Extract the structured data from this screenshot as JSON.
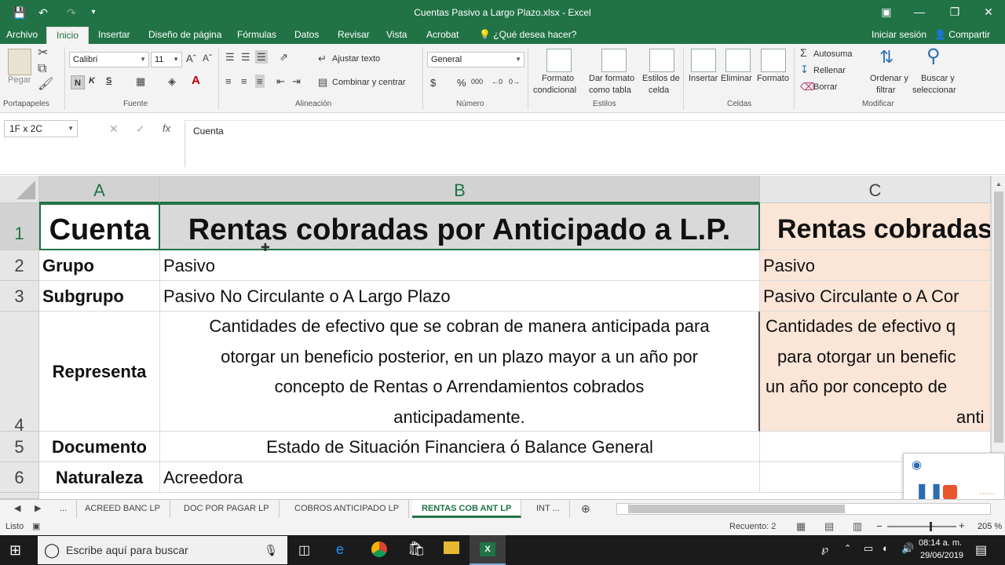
{
  "window": {
    "title": "Cuentas Pasivo a Largo Plazo.xlsx - Excel",
    "accent": "#217346"
  },
  "ribbon_tabs": [
    "Archivo",
    "Inicio",
    "Insertar",
    "Diseño de página",
    "Fórmulas",
    "Datos",
    "Revisar",
    "Vista",
    "Acrobat"
  ],
  "tell_me": "¿Qué desea hacer?",
  "signin": "Iniciar sesión",
  "share": "Compartir",
  "ribbon": {
    "paste": "Pegar",
    "font_name": "Calibri",
    "font_size": "11",
    "bold": "N",
    "italic": "K",
    "underline": "S",
    "wrap_text": "Ajustar texto",
    "merge_center": "Combinar y centrar",
    "number_format": "General",
    "conditional_format": [
      "Formato",
      "condicional"
    ],
    "format_as_table": [
      "Dar formato",
      "como tabla"
    ],
    "cell_styles": [
      "Estilos de",
      "celda"
    ],
    "insert": "Insertar",
    "delete": "Eliminar",
    "format": "Formato",
    "autosum": "Autosuma",
    "fill": "Rellenar",
    "clear": "Borrar",
    "sort_filter": [
      "Ordenar y",
      "filtrar"
    ],
    "find_select": [
      "Buscar y",
      "seleccionar"
    ],
    "groups": [
      "Portapapeles",
      "Fuente",
      "Alineación",
      "Número",
      "Estilos",
      "Celdas",
      "Modificar"
    ]
  },
  "formula_bar": {
    "name_box": "1F x 2C",
    "fx": "fx",
    "content": "Cuenta"
  },
  "columns": [
    "A",
    "B",
    "C"
  ],
  "rows": [
    "1",
    "2",
    "3",
    "4",
    "5",
    "6"
  ],
  "cells": {
    "A1": "Cuenta",
    "B1": "Rentas cobradas por Anticipado a L.P.",
    "C1": "Rentas cobradas",
    "A2": "Grupo",
    "B2": "Pasivo",
    "C2": "Pasivo",
    "A3": "Subgrupo",
    "B3": "Pasivo No Circulante o A Largo Plazo",
    "C3": "Pasivo Circulante o A Cor",
    "A4": "Representa",
    "B4": [
      "Cantidades de efectivo que se cobran de manera anticipada para",
      "otorgar  un beneficio posterior, en un plazo mayor a un año por",
      "concepto de Rentas o Arrendamientos cobrados",
      "anticipadamente."
    ],
    "C4": [
      "Cantidades de efectivo q",
      "para otorgar  un benefic",
      "un año por concepto de",
      "anti"
    ],
    "A5": "Documento",
    "B5": "Estado de Situación Financiera ó Balance General",
    "A6": "Naturaleza",
    "B6": "Acreedora"
  },
  "sheet_tabs": [
    "...",
    "ACREED BANC LP",
    "DOC POR PAGAR LP",
    "COBROS ANTICIPADO LP",
    "RENTAS COB ANT LP",
    "INT ..."
  ],
  "status": {
    "ready": "Listo",
    "count": "Recuento: 2",
    "zoom": "205 %"
  },
  "taskbar": {
    "search_placeholder": "Escribe aquí para buscar",
    "time": "08:14 a. m.",
    "date": "29/06/2019"
  }
}
